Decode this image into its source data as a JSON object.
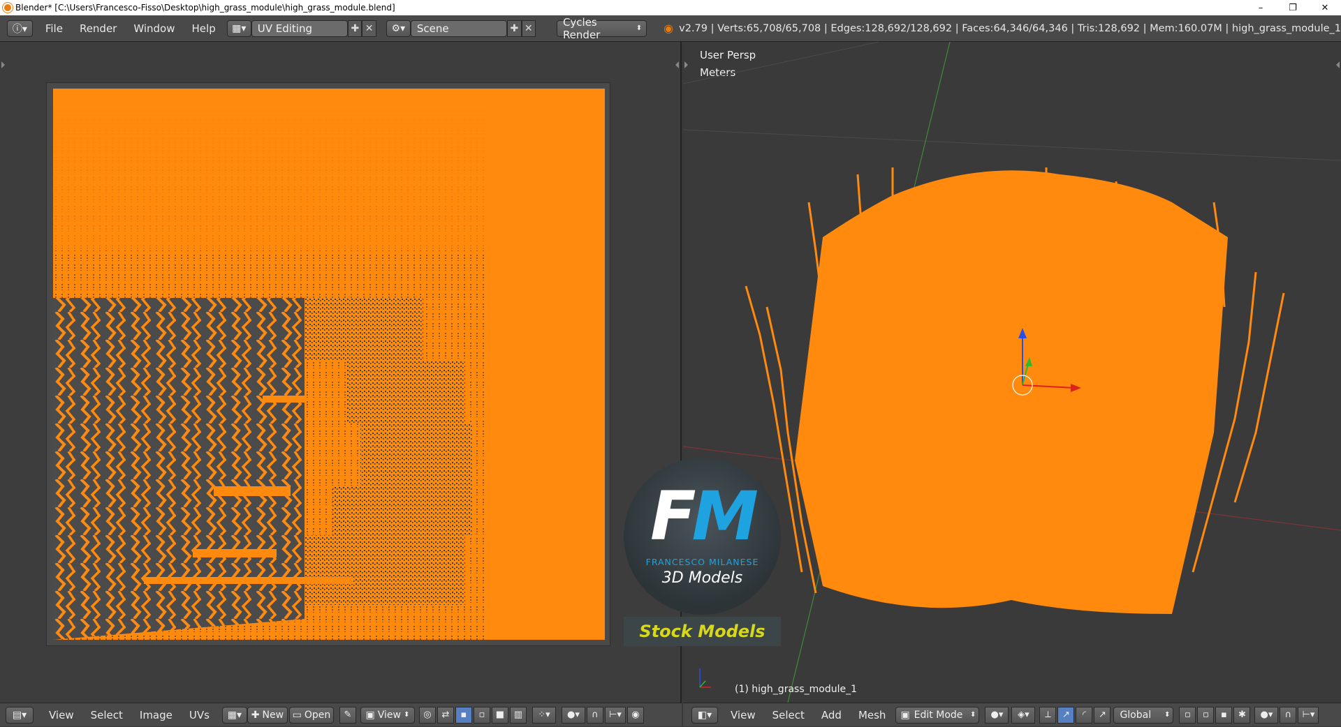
{
  "window": {
    "title": "Blender* [C:\\Users\\Francesco-Fisso\\Desktop\\high_grass_module\\high_grass_module.blend]",
    "minimize": "–",
    "restore": "❐",
    "close": "✕"
  },
  "info_header": {
    "menus": [
      "File",
      "Render",
      "Window",
      "Help"
    ],
    "screen_layout": "UV Editing",
    "scene": "Scene",
    "render_engine": "Cycles Render",
    "stats": "v2.79 | Verts:65,708/65,708 | Edges:128,692/128,692 | Faces:64,346/64,346 | Tris:128,692 | Mem:160.07M | high_grass_module_1"
  },
  "viewport": {
    "view_name": "User Persp",
    "units": "Meters",
    "object_label": "(1) high_grass_module_1"
  },
  "uv_editor_header": {
    "menus": [
      "View",
      "Select",
      "Image",
      "UVs"
    ],
    "new_label": "New",
    "open_label": "Open",
    "view_label": "View"
  },
  "viewport_header": {
    "menus": [
      "View",
      "Select",
      "Add",
      "Mesh"
    ],
    "mode": "Edit Mode",
    "orientation": "Global"
  },
  "watermark": {
    "fm_f": "F",
    "fm_m": "M",
    "name": "FRANCESCO MILANESE",
    "subtitle": "3D Models",
    "stock": "Stock Models"
  },
  "colors": {
    "mesh_orange": "#ff8a0d",
    "accent_blue": "#1fa3e0",
    "stock_yellow": "#d8d81a"
  }
}
